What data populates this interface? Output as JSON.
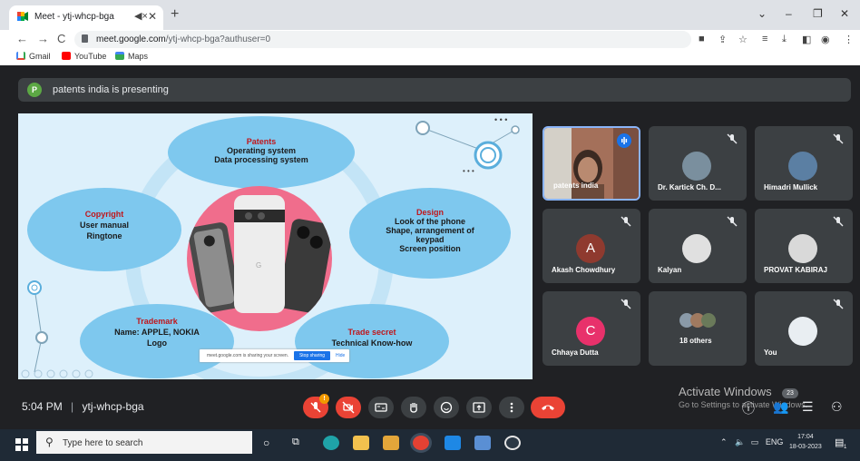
{
  "browser": {
    "tab_title": "Meet - ytj-whcp-bga",
    "url_host": "meet.google.com",
    "url_path": "/ytj-whcp-bga?authuser=0",
    "bookmarks": [
      "Gmail",
      "YouTube",
      "Maps"
    ]
  },
  "meet": {
    "presenter_initial": "P",
    "presenter_text": "patents india is presenting",
    "time": "5:04 PM",
    "separator": "|",
    "meeting_code": "ytj-whcp-bga",
    "mic_badge": "!",
    "participant_count": "23"
  },
  "slide": {
    "patents": {
      "title": "Patents",
      "line1": "Operating system",
      "line2": "Data processing system"
    },
    "copyright": {
      "title": "Copyright",
      "line1": "User manual",
      "line2": "Ringtone"
    },
    "design": {
      "title": "Design",
      "line1": "Look of the phone",
      "line2": "Shape, arrangement of",
      "line3": "keypad",
      "line4": "Screen position"
    },
    "trademark": {
      "title": "Trademark",
      "line1": "Name: APPLE, NOKIA",
      "line2": "Logo"
    },
    "tradesecret": {
      "title": "Trade secret",
      "line1": "Technical Know-how"
    },
    "share_msg": "meet.google.com is sharing your screen.",
    "stop_sharing": "Stop sharing",
    "hide": "Hide"
  },
  "tiles": [
    {
      "name": "patents india"
    },
    {
      "name": "Dr. Kartick Ch. D..."
    },
    {
      "name": "Himadri Mullick"
    },
    {
      "name": "Akash Chowdhury",
      "initial": "A",
      "color": "#8f3a2f"
    },
    {
      "name": "Kalyan"
    },
    {
      "name": "PROVAT KABIRAJ"
    },
    {
      "name": "Chhaya Dutta",
      "initial": "C",
      "color": "#e8316b"
    },
    {
      "name": "18 others"
    },
    {
      "name": "You"
    }
  ],
  "watermark": {
    "title": "Activate Windows",
    "subtitle": "Go to Settings to activate Windows."
  },
  "taskbar": {
    "search_placeholder": "Type here to search",
    "lang": "ENG",
    "time": "17:04",
    "date": "18-03-2023",
    "notif": "1"
  },
  "colors": {
    "meet_bg": "#202124",
    "tile_bg": "#3c4043",
    "end_call": "#ea4335",
    "active_border": "#8ab4f8"
  }
}
